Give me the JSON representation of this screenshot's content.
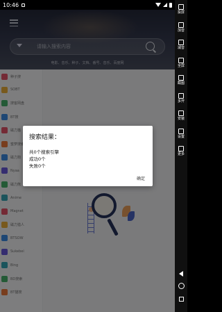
{
  "status_bar": {
    "time": "10:46"
  },
  "search": {
    "placeholder": "请输入搜索内容",
    "tags": "电影、音乐、种子、文档、番号、音乐、百度网"
  },
  "sidebar": {
    "items": [
      {
        "label": "种子搜",
        "color": "#e8556b"
      },
      {
        "label": "SOBT",
        "color": "#f0b23a"
      },
      {
        "label": "搜客网盘",
        "color": "#49b56c"
      },
      {
        "label": "BT搜",
        "color": "#3c8ee8"
      },
      {
        "label": "磁力猫",
        "color": "#e8556b"
      },
      {
        "label": "蜜萝搜索",
        "color": "#f07a3a"
      },
      {
        "label": "磁力狗",
        "color": "#3c8ee8"
      },
      {
        "label": "Nyaa",
        "color": "#6b5be0"
      },
      {
        "label": "磁力熊",
        "color": "#49b56c"
      },
      {
        "label": "Anime",
        "color": "#37a8b8"
      },
      {
        "label": "Magnet",
        "color": "#e8556b"
      },
      {
        "label": "磁力猎人",
        "color": "#f0b23a"
      },
      {
        "label": "BTSOW",
        "color": "#3c8ee8"
      },
      {
        "label": "Sukebei",
        "color": "#6b5be0"
      },
      {
        "label": "Bing",
        "color": "#37a8b8"
      },
      {
        "label": "BD搜索",
        "color": "#49b56c"
      },
      {
        "label": "BT猫搜",
        "color": "#f07a3a"
      }
    ]
  },
  "dialog": {
    "title": "搜索结果：",
    "line1": "共0个搜索引擎",
    "line2": "成功0个",
    "line3": "失败0个",
    "ok": "确定"
  },
  "right_toolbar": {
    "items": [
      {
        "label": "投屏",
        "icon": "cast-icon"
      },
      {
        "label": "加音",
        "icon": "volume-up-icon"
      },
      {
        "label": "减音",
        "icon": "volume-down-icon"
      },
      {
        "label": "全屏",
        "icon": "fullscreen-icon"
      },
      {
        "label": "截图",
        "icon": "screenshot-icon"
      },
      {
        "label": "多开",
        "icon": "multi-window-icon"
      },
      {
        "label": "安装",
        "icon": "install-icon"
      },
      {
        "label": "设置",
        "icon": "settings-icon"
      },
      {
        "label": "更多",
        "icon": "more-icon"
      }
    ]
  }
}
